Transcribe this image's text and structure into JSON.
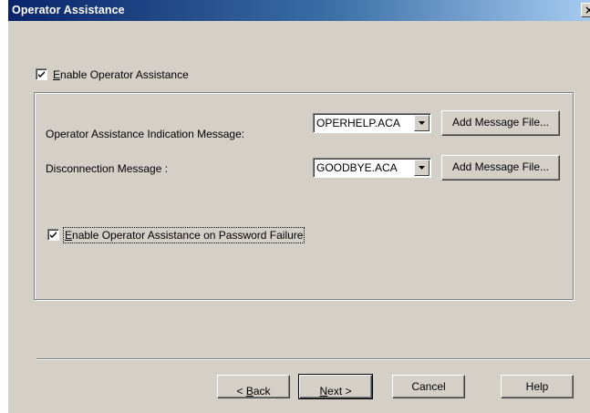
{
  "window": {
    "title": "Operator Assistance",
    "close_glyph": "×"
  },
  "enable_operator_assistance": {
    "checked": true,
    "label_prefix": "",
    "label_access_key": "E",
    "label_rest": "nable Operator Assistance"
  },
  "group": {
    "indication_label": "Operator Assistance Indication Message:",
    "indication_value": "OPERHELP.ACA",
    "disconnection_label": "Disconnection Message :",
    "disconnection_value": "GOODBYE.ACA",
    "add_message_file_label": "Add Message File...",
    "password_failure": {
      "checked": true,
      "label_access_key": "E",
      "label_rest": "nable Operator Assistance on Password Failure"
    }
  },
  "footer": {
    "back_prefix": "< ",
    "back_key": "B",
    "back_rest": "ack",
    "next_key": "N",
    "next_rest": "ext >",
    "cancel_label": "Cancel",
    "help_label": "Help"
  },
  "icons": {
    "checkmark": "checkmark-icon",
    "dropdown": "chevron-down-icon",
    "close": "close-icon"
  }
}
